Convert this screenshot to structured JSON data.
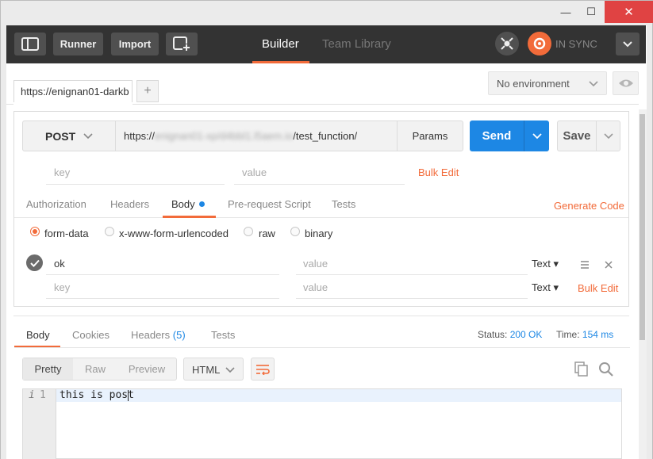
{
  "window": {
    "minimize": "—",
    "maximize": "☐",
    "close": "✕"
  },
  "toolbar": {
    "runner_label": "Runner",
    "import_label": "Import",
    "tabs": [
      {
        "label": "Builder"
      },
      {
        "label": "Team Library"
      }
    ],
    "sync_label": "IN SYNC"
  },
  "request_tab": {
    "label": "https://enignan01-darkb",
    "add": "+"
  },
  "environment": {
    "selected": "No environment"
  },
  "request": {
    "method": "POST",
    "url_blurred": "enignan01-xp/d4bbl1.l5aem.io",
    "url_prefix": "https://",
    "url_suffix": "/test_function/",
    "params_label": "Params",
    "send_label": "Send",
    "save_label": "Save",
    "param_key_placeholder": "key",
    "param_value_placeholder": "value",
    "bulk_edit": "Bulk Edit"
  },
  "request_tabs": [
    {
      "label": "Authorization"
    },
    {
      "label": "Headers"
    },
    {
      "label": "Body"
    },
    {
      "label": "Pre-request Script"
    },
    {
      "label": "Tests"
    }
  ],
  "generate_code": "Generate Code",
  "body_modes": [
    {
      "label": "form-data",
      "selected": true
    },
    {
      "label": "x-www-form-urlencoded",
      "selected": false
    },
    {
      "label": "raw",
      "selected": false
    },
    {
      "label": "binary",
      "selected": false
    }
  ],
  "form_rows": [
    {
      "key": "ok",
      "value_placeholder": "value",
      "type": "Text ▾"
    },
    {
      "key_placeholder": "key",
      "value_placeholder": "value",
      "type": "Text ▾"
    }
  ],
  "form_bulk_edit": "Bulk Edit",
  "response": {
    "tabs": [
      {
        "label": "Body"
      },
      {
        "label": "Cookies"
      },
      {
        "label": "Headers"
      },
      {
        "label": "Tests"
      }
    ],
    "headers_count": "(5)",
    "status_label": "Status:",
    "status_value": "200 OK",
    "time_label": "Time:",
    "time_value": "154 ms",
    "view_modes": [
      {
        "label": "Pretty"
      },
      {
        "label": "Raw"
      },
      {
        "label": "Preview"
      }
    ],
    "format": "HTML",
    "line_marker": "i",
    "line_number": "1",
    "body_text": "this is post"
  },
  "colors": {
    "accent": "#f26b3a",
    "primary": "#1d87e4",
    "toolbar": "#333333"
  }
}
